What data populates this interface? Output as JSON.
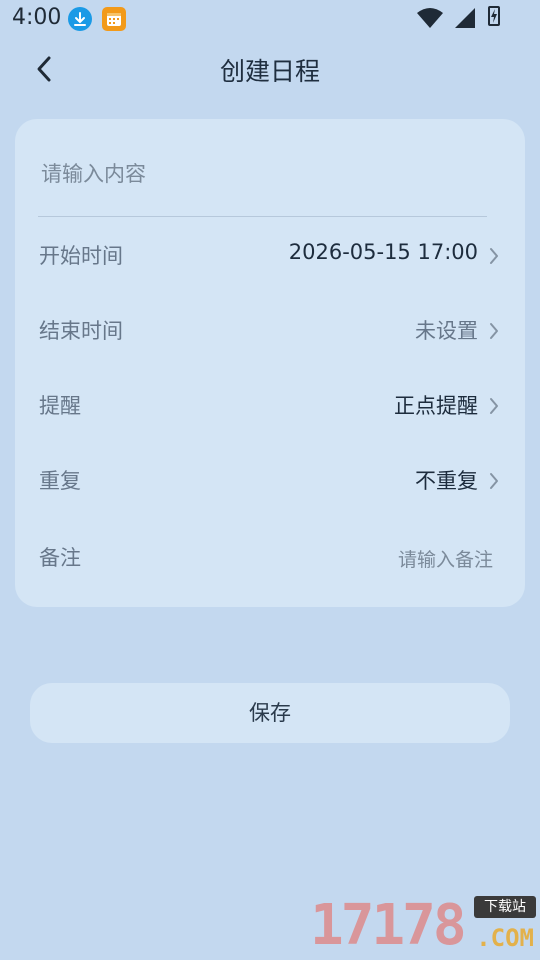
{
  "status_bar": {
    "time": "4:00",
    "icons": [
      "download-icon",
      "calendar-icon",
      "wifi-icon",
      "signal-icon",
      "battery-icon"
    ]
  },
  "header": {
    "title": "创建日程",
    "back_icon": "chevron-left-icon"
  },
  "form": {
    "content_placeholder": "请输入内容",
    "rows": [
      {
        "label": "开始时间",
        "value": "2026-05-15 17:00",
        "muted": false
      },
      {
        "label": "结束时间",
        "value": "未设置",
        "muted": true
      },
      {
        "label": "提醒",
        "value": "正点提醒",
        "muted": false
      },
      {
        "label": "重复",
        "value": "不重复",
        "muted": false
      }
    ],
    "note": {
      "label": "备注",
      "placeholder": "请输入备注"
    }
  },
  "actions": {
    "save_label": "保存"
  },
  "watermark": {
    "number": "17178",
    "tag": "下载站",
    "domain": ".COM"
  },
  "colors": {
    "background": "#c3d8ef",
    "card": "#d4e5f5",
    "text_primary": "#1d2c3d",
    "text_secondary": "#67778a"
  }
}
